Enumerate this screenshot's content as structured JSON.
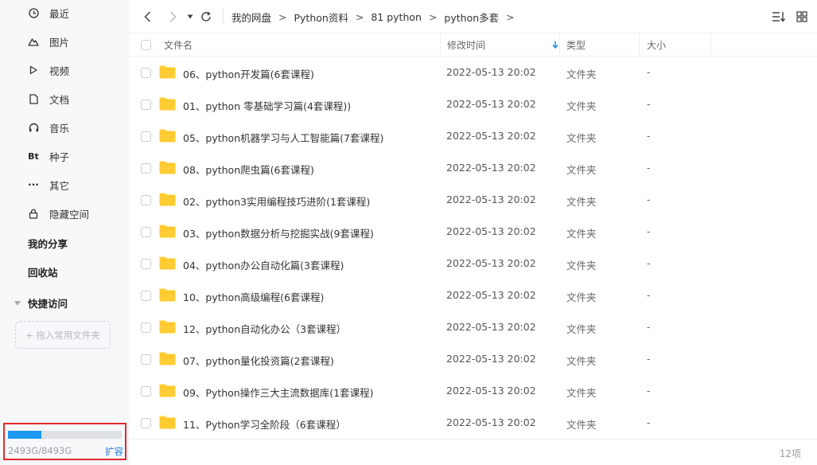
{
  "sidebar": {
    "items": [
      {
        "label": "最近",
        "icon": "clock-icon"
      },
      {
        "label": "图片",
        "icon": "mountain-icon"
      },
      {
        "label": "视频",
        "icon": "play-icon"
      },
      {
        "label": "文档",
        "icon": "document-icon"
      },
      {
        "label": "音乐",
        "icon": "headphones-icon"
      },
      {
        "label": "种子",
        "icon": "bt-icon",
        "glyph": "Bt"
      },
      {
        "label": "其它",
        "icon": "more-icon",
        "glyph": "···"
      },
      {
        "label": "隐藏空间",
        "icon": "lock-icon"
      }
    ],
    "share": "我的分享",
    "recycle": "回收站",
    "quick_access": "快捷访问",
    "drop_hint": "+ 拖入常用文件夹"
  },
  "quota": {
    "used_text": "2493G/8493G",
    "used_fraction": 0.2935,
    "expand": "扩容",
    "accent": "#1c99f0",
    "highlight": "#e4282e"
  },
  "breadcrumb": {
    "items": [
      "我的网盘",
      "Python资料",
      "81 python",
      "python多套"
    ],
    "separator": ">"
  },
  "table": {
    "columns": {
      "name": "文件名",
      "modified": "修改时间",
      "type": "类型",
      "size": "大小"
    },
    "rows": [
      {
        "name": "06、python开发篇(6套课程)",
        "modified": "2022-05-13 20:02",
        "type": "文件夹",
        "size": "-"
      },
      {
        "name": "01、python 零基础学习篇(4套课程))",
        "modified": "2022-05-13 20:02",
        "type": "文件夹",
        "size": "-"
      },
      {
        "name": "05、python机器学习与人工智能篇(7套课程)",
        "modified": "2022-05-13 20:02",
        "type": "文件夹",
        "size": "-"
      },
      {
        "name": "08、python爬虫篇(6套课程)",
        "modified": "2022-05-13 20:02",
        "type": "文件夹",
        "size": "-"
      },
      {
        "name": "02、python3实用编程技巧进阶(1套课程)",
        "modified": "2022-05-13 20:02",
        "type": "文件夹",
        "size": "-"
      },
      {
        "name": "03、python数据分析与挖掘实战(9套课程)",
        "modified": "2022-05-13 20:02",
        "type": "文件夹",
        "size": "-"
      },
      {
        "name": "04、python办公自动化篇(3套课程)",
        "modified": "2022-05-13 20:02",
        "type": "文件夹",
        "size": "-"
      },
      {
        "name": "10、python高级编程(6套课程)",
        "modified": "2022-05-13 20:02",
        "type": "文件夹",
        "size": "-"
      },
      {
        "name": "12、python自动化办公（3套课程）",
        "modified": "2022-05-13 20:02",
        "type": "文件夹",
        "size": "-"
      },
      {
        "name": "07、python量化投资篇(2套课程)",
        "modified": "2022-05-13 20:02",
        "type": "文件夹",
        "size": "-"
      },
      {
        "name": "09、Python操作三大主流数据库(1套课程)",
        "modified": "2022-05-13 20:02",
        "type": "文件夹",
        "size": "-"
      },
      {
        "name": "11、Python学习全阶段（6套课程）",
        "modified": "2022-05-13 20:02",
        "type": "文件夹",
        "size": "-"
      }
    ]
  },
  "footer": {
    "count": "12项"
  },
  "colors": {
    "folder": "#ffcc33",
    "sort_arrow": "#1f8ee6"
  }
}
